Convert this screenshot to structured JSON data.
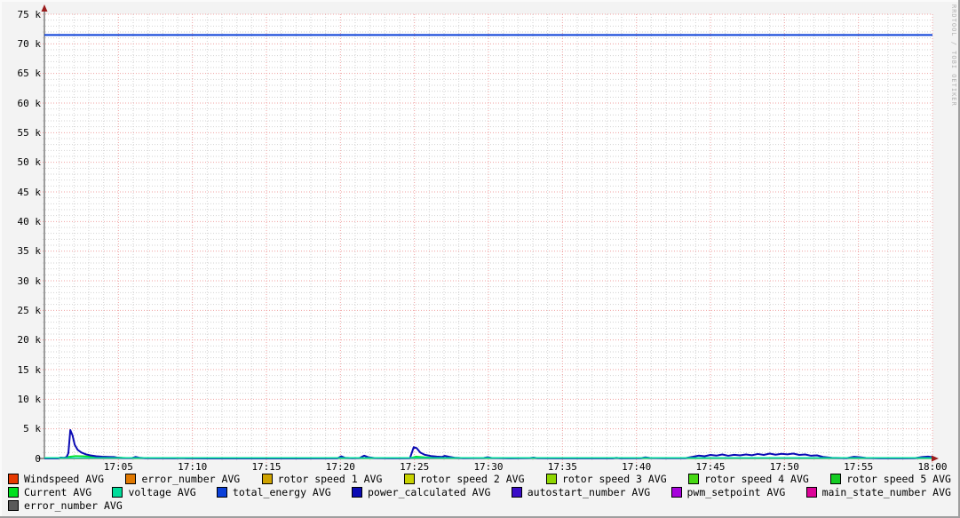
{
  "watermark": "RRDTOOL / TOBI OETIKER",
  "chart_data": {
    "type": "line",
    "title": "",
    "x_axis": {
      "start": "17:00",
      "end": "18:00",
      "major_tick_minutes": 5,
      "minor_tick_minutes": 1,
      "tick_labels": [
        "17:05",
        "17:10",
        "17:15",
        "17:20",
        "17:25",
        "17:30",
        "17:35",
        "17:40",
        "17:45",
        "17:50",
        "17:55",
        "18:00"
      ]
    },
    "y_axis": {
      "min": 0,
      "max": 75000,
      "major_step": 5000,
      "minor_step": 1000,
      "tick_labels": [
        "0",
        "5 k",
        "10 k",
        "15 k",
        "20 k",
        "25 k",
        "30 k",
        "35 k",
        "40 k",
        "45 k",
        "50 k",
        "55 k",
        "60 k",
        "65 k",
        "70 k",
        "75 k"
      ]
    },
    "colors": {
      "background": "#f3f3f3",
      "canvas": "#ffffff",
      "minor_grid": "#d2d2d2",
      "major_grid": "#f0a0a0",
      "axis": "#5f5f5f",
      "arrow": "#9b1d1d",
      "text": "#000000",
      "watermark": "#b3b3b3"
    },
    "series": [
      {
        "name": "total_energy AVG",
        "color": "#0a3fd8",
        "width": 2,
        "points": [
          [
            0,
            71500
          ],
          [
            60,
            71500
          ]
        ]
      },
      {
        "name": "Current AVG",
        "color": "#00e020",
        "width": 1.6,
        "points": [
          [
            0,
            70
          ],
          [
            1.2,
            70
          ],
          [
            1.7,
            320
          ],
          [
            2.1,
            430
          ],
          [
            2.7,
            380
          ],
          [
            3.5,
            310
          ],
          [
            4.4,
            260
          ],
          [
            5,
            160
          ],
          [
            5.7,
            90
          ],
          [
            7,
            60
          ],
          [
            20,
            60
          ],
          [
            24.7,
            70
          ],
          [
            25.1,
            330
          ],
          [
            25.7,
            210
          ],
          [
            26.5,
            110
          ],
          [
            28,
            70
          ],
          [
            44,
            70
          ],
          [
            47,
            110
          ],
          [
            50,
            100
          ],
          [
            53,
            80
          ],
          [
            60,
            60
          ]
        ]
      },
      {
        "name": "power_calculated AVG",
        "color": "#0b0bb4",
        "width": 2,
        "points": [
          [
            0,
            10
          ],
          [
            0.9,
            10
          ],
          [
            1.1,
            150
          ],
          [
            1.35,
            120
          ],
          [
            1.5,
            250
          ],
          [
            1.62,
            900
          ],
          [
            1.75,
            4800
          ],
          [
            1.9,
            3900
          ],
          [
            2.05,
            2300
          ],
          [
            2.25,
            1450
          ],
          [
            2.5,
            1000
          ],
          [
            2.8,
            700
          ],
          [
            3.1,
            520
          ],
          [
            3.5,
            380
          ],
          [
            3.9,
            300
          ],
          [
            4.3,
            270
          ],
          [
            4.7,
            250
          ],
          [
            4.9,
            150
          ],
          [
            5.3,
            70
          ],
          [
            5.9,
            70
          ],
          [
            6.15,
            260
          ],
          [
            6.4,
            140
          ],
          [
            6.8,
            50
          ],
          [
            8.8,
            30
          ],
          [
            9.2,
            70
          ],
          [
            9.6,
            30
          ],
          [
            11,
            20
          ],
          [
            14,
            20
          ],
          [
            17,
            20
          ],
          [
            19.8,
            40
          ],
          [
            20.05,
            360
          ],
          [
            20.3,
            120
          ],
          [
            20.8,
            60
          ],
          [
            21.3,
            90
          ],
          [
            21.6,
            470
          ],
          [
            21.9,
            200
          ],
          [
            22.3,
            70
          ],
          [
            23.5,
            30
          ],
          [
            24.7,
            60
          ],
          [
            24.95,
            1900
          ],
          [
            25.15,
            1750
          ],
          [
            25.4,
            1000
          ],
          [
            25.7,
            620
          ],
          [
            26.1,
            420
          ],
          [
            26.5,
            320
          ],
          [
            26.85,
            260
          ],
          [
            27.05,
            430
          ],
          [
            27.35,
            280
          ],
          [
            27.7,
            130
          ],
          [
            28.3,
            60
          ],
          [
            29.7,
            90
          ],
          [
            29.95,
            210
          ],
          [
            30.2,
            90
          ],
          [
            31.5,
            40
          ],
          [
            32.8,
            70
          ],
          [
            33.05,
            150
          ],
          [
            33.3,
            60
          ],
          [
            35,
            30
          ],
          [
            38.4,
            40
          ],
          [
            38.65,
            110
          ],
          [
            38.9,
            40
          ],
          [
            40.3,
            60
          ],
          [
            40.6,
            190
          ],
          [
            40.9,
            90
          ],
          [
            41.8,
            50
          ],
          [
            43.3,
            60
          ],
          [
            43.8,
            280
          ],
          [
            44.2,
            480
          ],
          [
            44.6,
            380
          ],
          [
            45,
            600
          ],
          [
            45.4,
            480
          ],
          [
            45.8,
            680
          ],
          [
            46.2,
            460
          ],
          [
            46.6,
            620
          ],
          [
            47,
            520
          ],
          [
            47.4,
            680
          ],
          [
            47.8,
            540
          ],
          [
            48.2,
            760
          ],
          [
            48.6,
            600
          ],
          [
            49,
            820
          ],
          [
            49.4,
            640
          ],
          [
            49.8,
            780
          ],
          [
            50.2,
            700
          ],
          [
            50.6,
            820
          ],
          [
            51,
            600
          ],
          [
            51.4,
            680
          ],
          [
            51.8,
            460
          ],
          [
            52.2,
            520
          ],
          [
            52.6,
            260
          ],
          [
            53.2,
            120
          ],
          [
            54.2,
            60
          ],
          [
            54.7,
            280
          ],
          [
            55.1,
            200
          ],
          [
            55.5,
            90
          ],
          [
            56.5,
            40
          ],
          [
            58.8,
            50
          ],
          [
            59.3,
            240
          ],
          [
            59.7,
            320
          ],
          [
            60,
            220
          ]
        ]
      },
      {
        "name": "voltage AVG",
        "color": "#00dc9a",
        "width": 1.6,
        "points": [
          [
            0,
            110
          ],
          [
            60,
            110
          ]
        ]
      }
    ],
    "legend_rows": [
      [
        {
          "label": "Windspeed AVG",
          "color": "#e63900"
        },
        {
          "label": "error_number AVG",
          "color": "#e07800"
        },
        {
          "label": "rotor speed 1 AVG",
          "color": "#cfa300"
        },
        {
          "label": "rotor speed 2 AVG",
          "color": "#c8d200"
        },
        {
          "label": "rotor speed 3 AVG",
          "color": "#8fd600"
        },
        {
          "label": "rotor speed 4 AVG",
          "color": "#46d813"
        },
        {
          "label": "rotor speed 5 AVG",
          "color": "#14cc23"
        }
      ],
      [
        {
          "label": "Current AVG",
          "color": "#00e020"
        },
        {
          "label": "voltage AVG",
          "color": "#00dc9a"
        },
        {
          "label": "total_energy AVG",
          "color": "#0a3fd8"
        },
        {
          "label": "power_calculated AVG",
          "color": "#0b0bb4"
        },
        {
          "label": "autostart_number AVG",
          "color": "#3a0dc8"
        },
        {
          "label": "pwm_setpoint AVG",
          "color": "#a603dc"
        },
        {
          "label": "main_state_number AVG",
          "color": "#dc0498"
        }
      ],
      [
        {
          "label": "error_number AVG",
          "color": "#5a5a5a"
        }
      ]
    ]
  }
}
